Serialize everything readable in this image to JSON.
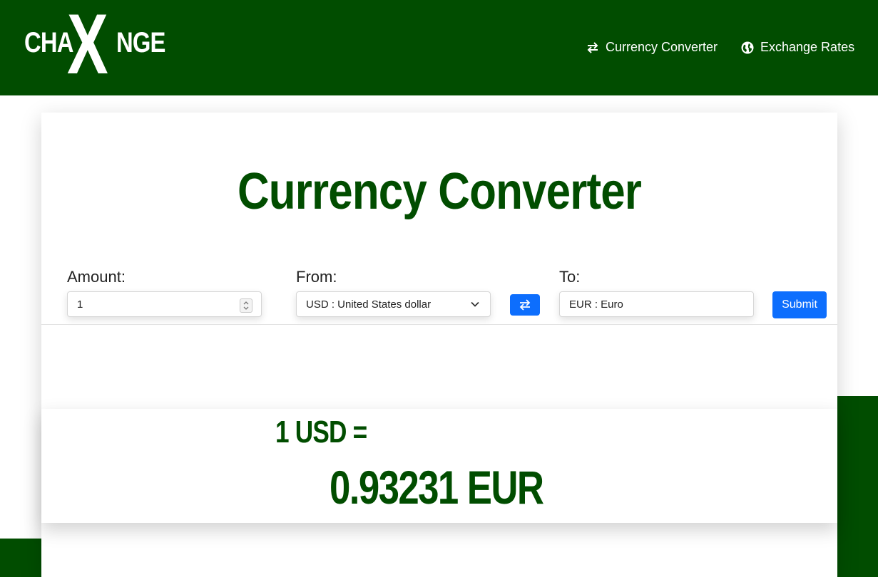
{
  "brand": {
    "left": "CHA",
    "x": "X",
    "right": "NGE"
  },
  "nav": [
    {
      "label": "Currency Converter",
      "icon": "swap-arrows-icon"
    },
    {
      "label": "Exchange Rates",
      "icon": "globe-icon"
    }
  ],
  "converter": {
    "title": "Currency Converter",
    "amount_label": "Amount:",
    "amount_value": "1",
    "from_label": "From:",
    "from_value": "USD : United States dollar",
    "to_label": "To:",
    "to_value": "EUR : Euro",
    "submit_label": "Submit"
  },
  "result": {
    "line1": "1 USD =",
    "line2": "0.93231 EUR"
  },
  "colors": {
    "brand_green": "#014d00",
    "primary_blue": "#0d6efd"
  }
}
